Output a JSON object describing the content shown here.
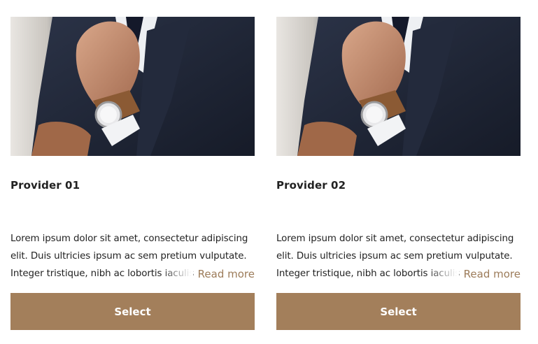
{
  "providers": [
    {
      "title": "Provider 01",
      "description": "Lorem ipsum dolor sit amet, consectetur adipiscing elit. Duis ultricies ipsum ac sem pretium vulputate. Integer tristique, nibh ac lobortis iaculis, ",
      "read_more_label": "Read more",
      "select_label": "Select"
    },
    {
      "title": "Provider 02",
      "description": "Lorem ipsum dolor sit amet, consectetur adipiscing elit. Duis ultricies ipsum ac sem pretium vulputate. Integer tristique, nibh ac lobortis iaculis, ",
      "read_more_label": "Read more",
      "select_label": "Select"
    }
  ],
  "colors": {
    "accent": "#a37f5b",
    "link": "#9c7b59",
    "text": "#222222"
  }
}
